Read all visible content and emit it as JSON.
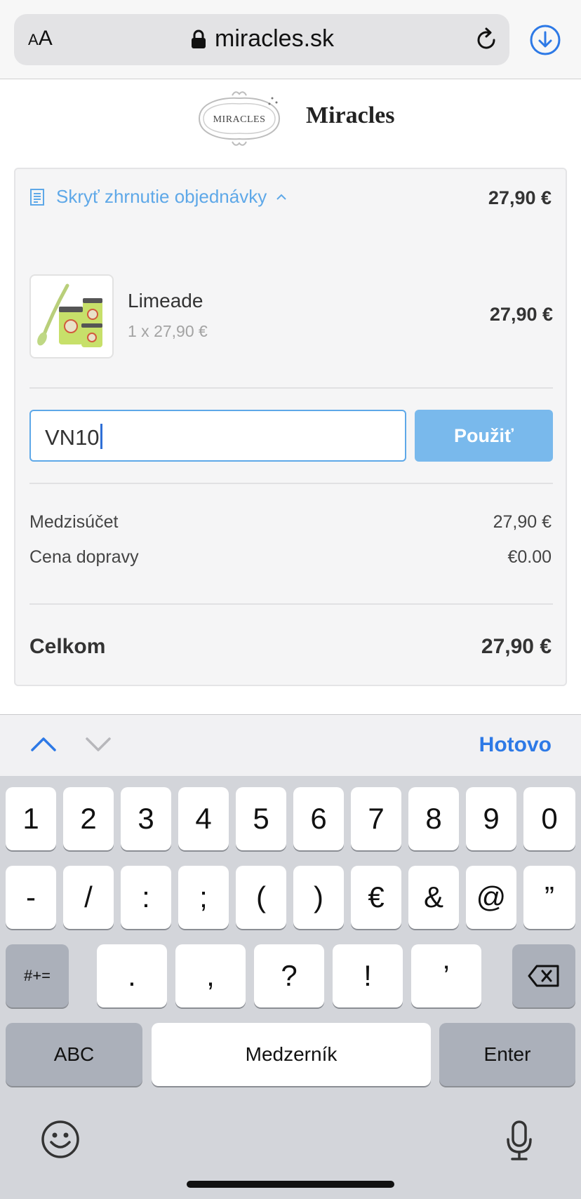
{
  "browser": {
    "text_size_button": {
      "small": "A",
      "large": "A"
    },
    "url": "miracles.sk",
    "icons": [
      "lock-icon",
      "reload-icon",
      "download-icon"
    ]
  },
  "store": {
    "logo_text": "MIRACLES",
    "name": "Miracles"
  },
  "summary": {
    "toggle_label": "Skryť zhrnutie objednávky",
    "toggle_total": "27,90 €",
    "accent_color": "#5ea8e8",
    "product": {
      "name": "Limeade",
      "quantity_line": "1 x 27,90 €",
      "price": "27,90 €"
    },
    "discount": {
      "value": "VN10",
      "apply_label": "Použiť"
    },
    "lines": [
      {
        "label": "Medzisúčet",
        "value": "27,90 €"
      },
      {
        "label": "Cena dopravy",
        "value": "€0.00"
      }
    ],
    "total_label": "Celkom",
    "total_value": "27,90 €"
  },
  "accessory_bar": {
    "done_label": "Hotovo",
    "icons": [
      "chevron-up-icon",
      "chevron-down-icon"
    ]
  },
  "keyboard": {
    "row1": [
      "1",
      "2",
      "3",
      "4",
      "5",
      "6",
      "7",
      "8",
      "9",
      "0"
    ],
    "row2": [
      "-",
      "/",
      ":",
      ";",
      "(",
      ")",
      "€",
      "&",
      "@",
      "”"
    ],
    "row3": {
      "symbols_key": "#+=",
      "keys": [
        ".",
        ",",
        "?",
        "!",
        "’"
      ]
    },
    "row4": {
      "abc_key": "ABC",
      "space_key": "Medzerník",
      "enter_key": "Enter"
    },
    "icons": [
      "backspace-icon",
      "emoji-icon",
      "microphone-icon"
    ]
  }
}
